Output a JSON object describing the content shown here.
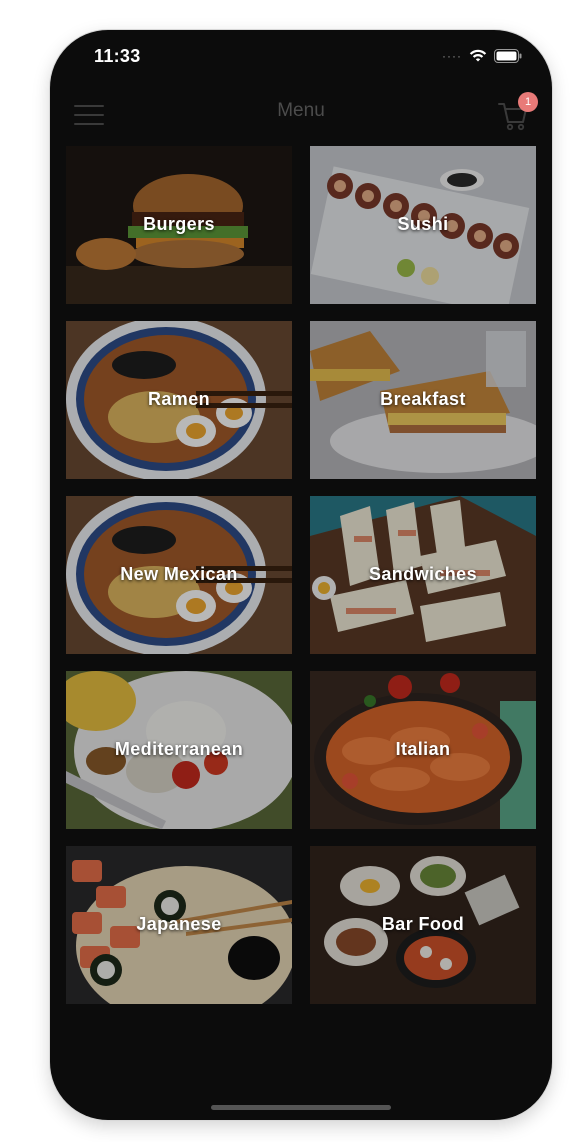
{
  "status_bar": {
    "time": "11:33",
    "signal_icon": "signal-dots-icon",
    "wifi_icon": "wifi-icon",
    "battery_icon": "battery-icon"
  },
  "nav": {
    "title": "Menu",
    "menu_icon": "hamburger-menu-icon",
    "cart_icon": "shopping-cart-icon",
    "cart_badge": "1"
  },
  "categories": [
    {
      "label": "Burgers"
    },
    {
      "label": "Sushi"
    },
    {
      "label": "Ramen"
    },
    {
      "label": "Breakfast"
    },
    {
      "label": "New Mexican"
    },
    {
      "label": "Sandwiches"
    },
    {
      "label": "Mediterranean"
    },
    {
      "label": "Italian"
    },
    {
      "label": "Japanese"
    },
    {
      "label": "Bar Food"
    }
  ],
  "colors": {
    "background": "#0c0c0c",
    "badge": "#e87a78",
    "nav_title": "#4c4c4c"
  }
}
